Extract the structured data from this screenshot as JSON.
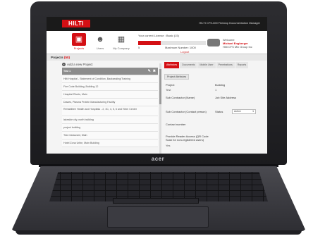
{
  "device": {
    "brand": "acer"
  },
  "app": {
    "logo": "HILTI",
    "title": "HILTI CFS-DM Firestop Documentation Manager"
  },
  "nav": {
    "tiles": [
      {
        "label": "Projects",
        "icon": "briefcase-icon",
        "active": true
      },
      {
        "label": "Users",
        "icon": "users-icon",
        "active": false
      },
      {
        "label": "My Company",
        "icon": "building-icon",
        "active": false
      }
    ]
  },
  "license": {
    "text": "Your current License : Basic (15)",
    "bar_value": 5,
    "bar_max": 15,
    "used_label": "5",
    "maximum_label": "Maximum Number: 1000",
    "logout": "Logout"
  },
  "welcome": {
    "line1": "Welcome",
    "name": "Michael Engberger",
    "line3": "Hilti CFS Mix Group Inc"
  },
  "projects": {
    "heading": "Projects",
    "count": "(50)",
    "add_label": "Add a new Project",
    "items": [
      {
        "text": "Test 1",
        "selected": true
      },
      {
        "text": "Hilti Hospital - Statement of Condition, Backsealing/Training",
        "selected": false
      },
      {
        "text": "Fire Code Building, Building 12",
        "selected": false
      },
      {
        "text": "Hospital Rivets, Main",
        "selected": false
      },
      {
        "text": "Dawes, Plasma Protein Manufacturing Facility",
        "selected": false
      },
      {
        "text": "Rehabilitee Health and Hospitals - 2, 3C, 4, 5, 6 and Heim Center",
        "selected": false,
        "tall": true
      },
      {
        "text": "lakeside city, north building",
        "selected": false
      },
      {
        "text": "project building",
        "selected": false
      },
      {
        "text": "Test restaurant, Main",
        "selected": false
      },
      {
        "text": "Hotel Zona Uribe, Main Building",
        "selected": false
      }
    ]
  },
  "detail": {
    "tabs": [
      {
        "label": "Attributes",
        "active": true
      },
      {
        "label": "Documents",
        "active": false
      },
      {
        "label": "Mobile User",
        "active": false
      },
      {
        "label": "Penetrations",
        "active": false
      },
      {
        "label": "Reports",
        "active": false
      }
    ],
    "subtab": "Project Attributes",
    "fields": {
      "project_label": "Project",
      "project_value": "Test",
      "building_label": "Building",
      "building_value": "1",
      "sub_name_label": "Sub Contractor (Name)",
      "job_site_label": "Job Site Address",
      "sub_contact_label": "Sub Contractor (Contact person)",
      "status_label": "Status",
      "status_value": "Active",
      "contact_label": "Contact number",
      "reader_label": "Provide Reader Access (QR Code Scan for non-registered users)",
      "reader_value": "Yes"
    }
  }
}
